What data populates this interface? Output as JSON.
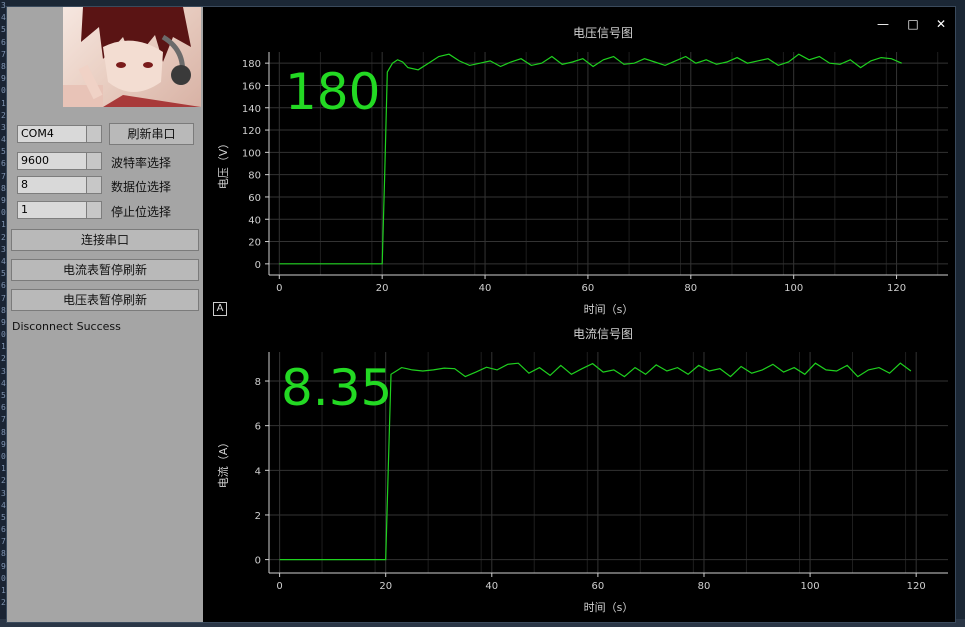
{
  "editor_gutter": [
    "3",
    "4",
    "5",
    "6",
    "7",
    "8",
    "9",
    "0",
    "1",
    "2",
    "3",
    "4",
    "5",
    "6",
    "7",
    "8",
    "9",
    "0",
    "1",
    "2",
    "3",
    "4",
    "5",
    "6",
    "7",
    "8",
    "9",
    "0",
    "1",
    "2",
    "3",
    "4",
    "5",
    "6",
    "7",
    "8",
    "9",
    "0",
    "1",
    "2",
    "3",
    "4",
    "5",
    "6",
    "7",
    "8",
    "9",
    "0",
    "1",
    "2"
  ],
  "window": {
    "minimize": "—",
    "maximize": "□",
    "close": "✕"
  },
  "serial": {
    "port_value": "COM4",
    "refresh_button": "刷新串口",
    "baud_value": "9600",
    "baud_label": "波特率选择",
    "databits_value": "8",
    "databits_label": "数据位选择",
    "stopbits_value": "1",
    "stopbits_label": "停止位选择",
    "connect_button": "连接串口",
    "current_pause_button": "电流表暂停刷新",
    "voltage_pause_button": "电压表暂停刷新",
    "status_text": "Disconnect Success"
  },
  "axis_icon_label": "A",
  "colors": {
    "trace": "#1fd11f",
    "big_value": "#23d923",
    "grid": "#333333",
    "axis": "#cfcfcf"
  },
  "chart_data": [
    {
      "type": "line",
      "title": "电压信号图",
      "xlabel": "时间（s）",
      "ylabel": "电压（V）",
      "display_value": "180",
      "x_ticks": [
        "0",
        "20",
        "40",
        "60",
        "80",
        "100",
        "120"
      ],
      "y_ticks": [
        "0",
        "20",
        "40",
        "60",
        "80",
        "100",
        "120",
        "140",
        "160",
        "180"
      ],
      "xlim": [
        -2,
        130
      ],
      "ylim": [
        -10,
        190
      ],
      "grid": true,
      "x": [
        0,
        20,
        20.5,
        21,
        22,
        23,
        24,
        25,
        27,
        29,
        31,
        33,
        35,
        37,
        39,
        41,
        43,
        45,
        47,
        49,
        51,
        53,
        55,
        57,
        59,
        61,
        63,
        65,
        67,
        69,
        71,
        73,
        75,
        77,
        79,
        81,
        83,
        85,
        87,
        89,
        91,
        93,
        95,
        97,
        99,
        101,
        103,
        105,
        107,
        109,
        111,
        113,
        115,
        117,
        119,
        121
      ],
      "y": [
        0,
        0,
        80,
        172,
        180,
        183,
        181,
        176,
        174,
        180,
        186,
        188,
        182,
        178,
        180,
        182,
        177,
        181,
        184,
        178,
        180,
        186,
        179,
        181,
        184,
        177,
        183,
        186,
        179,
        180,
        184,
        181,
        178,
        182,
        186,
        180,
        183,
        179,
        181,
        185,
        180,
        182,
        184,
        178,
        181,
        188,
        183,
        186,
        180,
        179,
        183,
        176,
        182,
        185,
        184,
        180
      ]
    },
    {
      "type": "line",
      "title": "电流信号图",
      "xlabel": "时间（s）",
      "ylabel": "电流（A）",
      "display_value": "8.35",
      "x_ticks": [
        "0",
        "20",
        "40",
        "60",
        "80",
        "100",
        "120"
      ],
      "y_ticks": [
        "0",
        "2",
        "4",
        "6",
        "8"
      ],
      "xlim": [
        -2,
        126
      ],
      "ylim": [
        -0.6,
        9.3
      ],
      "grid": true,
      "x": [
        0,
        20,
        20.5,
        21,
        22,
        23,
        24,
        25,
        27,
        29,
        31,
        33,
        35,
        37,
        39,
        41,
        43,
        45,
        47,
        49,
        51,
        53,
        55,
        57,
        59,
        61,
        63,
        65,
        67,
        69,
        71,
        73,
        75,
        77,
        79,
        81,
        83,
        85,
        87,
        89,
        91,
        93,
        95,
        97,
        99,
        101,
        103,
        105,
        107,
        109,
        111,
        113,
        115,
        117,
        119
      ],
      "y": [
        0,
        0,
        4.3,
        8.3,
        8.45,
        8.6,
        8.55,
        8.5,
        8.45,
        8.5,
        8.58,
        8.55,
        8.2,
        8.4,
        8.62,
        8.5,
        8.75,
        8.8,
        8.35,
        8.6,
        8.25,
        8.7,
        8.3,
        8.55,
        8.78,
        8.4,
        8.5,
        8.2,
        8.6,
        8.3,
        8.72,
        8.45,
        8.6,
        8.3,
        8.7,
        8.45,
        8.55,
        8.2,
        8.65,
        8.35,
        8.5,
        8.75,
        8.4,
        8.6,
        8.3,
        8.8,
        8.5,
        8.45,
        8.7,
        8.2,
        8.5,
        8.6,
        8.35,
        8.8,
        8.45
      ]
    }
  ]
}
